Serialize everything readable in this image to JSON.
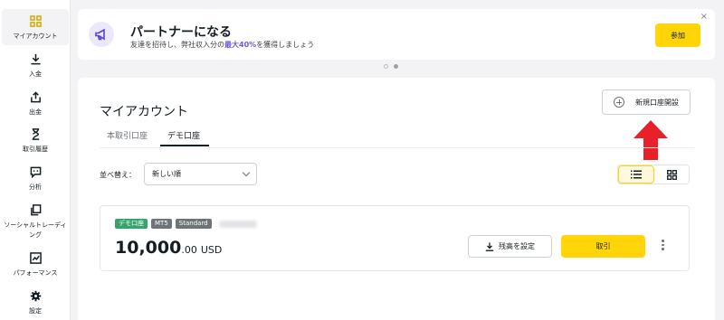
{
  "sidebar": {
    "items": [
      {
        "label": "マイアカウント",
        "icon": "grid-icon",
        "active": true
      },
      {
        "label": "入金",
        "icon": "download-icon"
      },
      {
        "label": "出金",
        "icon": "upload-icon"
      },
      {
        "label": "取引履歴",
        "icon": "hourglass-icon"
      },
      {
        "label": "分析",
        "icon": "chat-icon"
      },
      {
        "label": "ソーシャルトレーディング",
        "icon": "copy-icon"
      },
      {
        "label": "パフォーマンス",
        "icon": "chart-icon"
      },
      {
        "label": "設定",
        "icon": "gear-icon"
      }
    ]
  },
  "banner": {
    "title": "パートナーになる",
    "subtitle_pre": "友達を招待し、弊社収入分の",
    "subtitle_hl": "最大40%",
    "subtitle_post": "を獲得しましょう",
    "join_label": "参加",
    "close": "×"
  },
  "main": {
    "title": "マイアカウント",
    "open_account_label": "新規口座開設",
    "tabs": [
      {
        "label": "本取引口座"
      },
      {
        "label": "デモ口座",
        "active": true
      }
    ],
    "sort_label": "並べ替え：",
    "sort_value": "新しい順"
  },
  "account": {
    "tags": [
      "デモ口座",
      "MT5",
      "Standard"
    ],
    "balance_main": "10,000",
    "balance_decimal": ".00",
    "currency": "USD",
    "set_balance_label": "残高を設定",
    "trade_label": "取引"
  },
  "colors": {
    "accent": "#ffd50a",
    "demo_tag": "#35a36b",
    "arrow": "#e8202a",
    "highlight": "#6a5ae0"
  }
}
